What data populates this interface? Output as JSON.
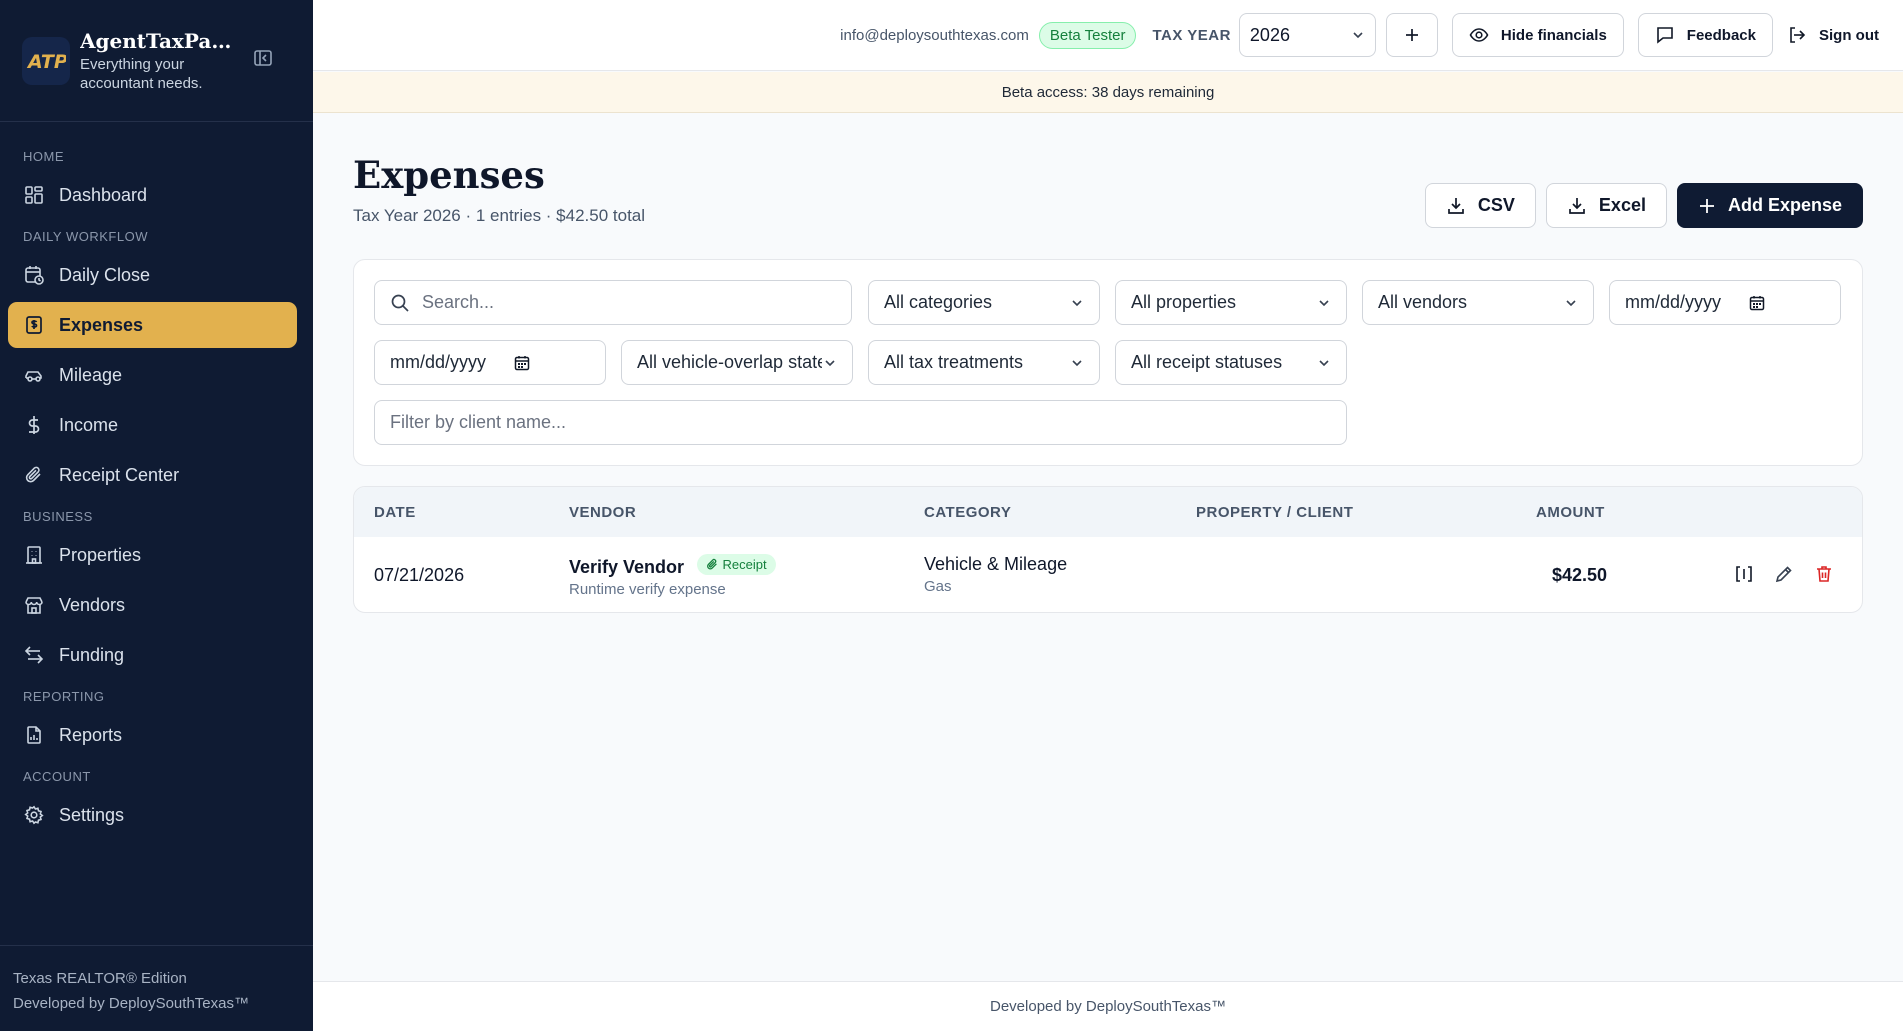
{
  "app": {
    "logo_text": "ATP",
    "title": "AgentTaxPack...",
    "subtitle": "Everything your accountant needs."
  },
  "sidebar": {
    "sections": {
      "home": "HOME",
      "daily_workflow": "DAILY WORKFLOW",
      "business": "BUSINESS",
      "reporting": "REPORTING",
      "account": "ACCOUNT"
    },
    "items": [
      {
        "label": "Dashboard",
        "icon": "dashboard-icon"
      },
      {
        "label": "Daily Close",
        "icon": "calendar-clock-icon"
      },
      {
        "label": "Expenses",
        "icon": "receipt-dollar-icon",
        "active": true
      },
      {
        "label": "Mileage",
        "icon": "car-icon"
      },
      {
        "label": "Income",
        "icon": "dollar-icon"
      },
      {
        "label": "Receipt Center",
        "icon": "paperclip-icon"
      },
      {
        "label": "Properties",
        "icon": "building-icon"
      },
      {
        "label": "Vendors",
        "icon": "store-icon"
      },
      {
        "label": "Funding",
        "icon": "arrows-left-right-icon"
      },
      {
        "label": "Reports",
        "icon": "report-chart-icon"
      },
      {
        "label": "Settings",
        "icon": "gear-icon"
      }
    ],
    "footer_line1": "Texas REALTOR® Edition",
    "footer_line2": "Developed by DeploySouthTexas™"
  },
  "topbar": {
    "email": "info@deploysouthtexas.com",
    "badge": "Beta Tester",
    "tax_year_label": "TAX YEAR",
    "tax_year_value": "2026",
    "hide_financials": "Hide financials",
    "feedback": "Feedback",
    "sign_out": "Sign out"
  },
  "banner": "Beta access: 38 days remaining",
  "page": {
    "title": "Expenses",
    "subtitle": "Tax Year 2026 · 1 entries · $42.50 total",
    "csv": "CSV",
    "excel": "Excel",
    "add": "Add Expense"
  },
  "filters": {
    "search_placeholder": "Search...",
    "categories": "All categories",
    "properties": "All properties",
    "vendors": "All vendors",
    "date_from": "mm/dd/yyyy",
    "date_to": "mm/dd/yyyy",
    "vehicle_overlap": "All vehicle-overlap states",
    "tax_treatments": "All tax treatments",
    "receipt_statuses": "All receipt statuses",
    "client_placeholder": "Filter by client name..."
  },
  "table": {
    "columns": [
      "DATE",
      "VENDOR",
      "CATEGORY",
      "PROPERTY / CLIENT",
      "AMOUNT"
    ],
    "rows": [
      {
        "date": "07/21/2026",
        "vendor": "Verify Vendor",
        "receipt_badge": "Receipt",
        "description": "Runtime verify expense",
        "category": "Vehicle & Mileage",
        "subcategory": "Gas",
        "property_client": "",
        "amount": "$42.50"
      }
    ]
  },
  "footer": "Developed by DeploySouthTexas™",
  "colors": {
    "sidebar_bg": "#0f1b33",
    "accent": "#e2b14e",
    "primary_button": "#0f1b33",
    "success": "#15803d",
    "danger": "#dc2626"
  }
}
